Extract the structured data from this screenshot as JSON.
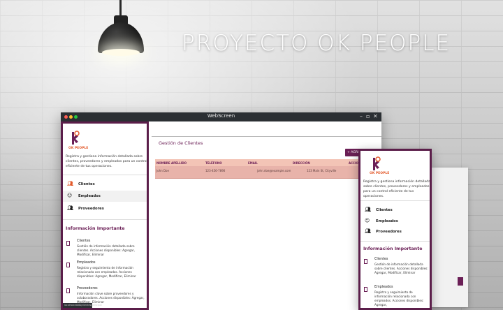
{
  "hero": {
    "title": "PROYECTO OK PEOPLE"
  },
  "window": {
    "title": "WebScreen"
  },
  "brand": {
    "logo_text": "OK PEOPLE"
  },
  "sidebar": {
    "intro": "Registra y gestiona información detallada sobre clientes, proveedores y empleados para un control eficiente de tus operaciones.",
    "items": [
      {
        "label": "Clientes",
        "icon": "users-icon"
      },
      {
        "label": "Empleados",
        "icon": "badge-icon"
      },
      {
        "label": "Proveedores",
        "icon": "people-icon"
      }
    ],
    "info_title": "Información Importante",
    "info": [
      {
        "title": "Clientes",
        "desc": "Gestión de información detallada sobre clientes. Acciones disponibles: Agregar, Modificar, Eliminar"
      },
      {
        "title": "Empleados",
        "desc": "Registro y seguimiento de información relacionada con empleados. Acciones disponibles: Agregar, Modificar, Eliminar"
      },
      {
        "title": "Proveedores",
        "desc": "Información clave sobre proveedores y colaboradores. Acciones disponibles: Agregar, Modificar, Eliminar"
      }
    ],
    "status_url": "localhost:8080/clientes/principal"
  },
  "main": {
    "heading": "Gestión de Clientes",
    "add_button": "+ AGREGAR",
    "table": {
      "headers": [
        "NOMBRE APELLIDO",
        "TELÉFONO",
        "EMAIL",
        "DIRECCIÓN",
        "ACCIONES"
      ],
      "rows": [
        [
          "John Doe",
          "123-456-7890",
          "john.doe@example.com",
          "123 Main St, Cityville",
          ""
        ]
      ]
    }
  },
  "mobile": {
    "intro": "Registra y gestiona información detallada sobre clientes, proveedores y empleados para un control eficiente de tus operaciones.",
    "items": [
      "Clientes",
      "Empleados",
      "Proveedores"
    ],
    "info_title": "Información Importante",
    "info": [
      {
        "title": "Clientes",
        "desc": "Gestión de información detallada sobre clientes. Acciones disponibles: Agregar, Modificar, Eliminar"
      },
      {
        "title": "Empleados",
        "desc": "Registro y seguimiento de información relacionada con empleados. Acciones disponibles: Agregar,"
      }
    ]
  },
  "colors": {
    "brand": "#6b1f56",
    "accent": "#e35a2b",
    "table_header": "#f3c4b6",
    "table_row": "#e8b3aa"
  }
}
